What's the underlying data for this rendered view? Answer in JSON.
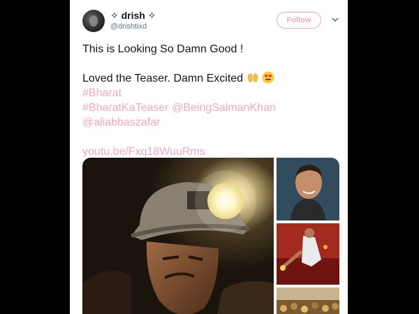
{
  "tweet": {
    "display_name": "drish",
    "name_ornament": "✧",
    "handle": "@drishtixd",
    "follow_label": "Follow",
    "lines": [
      {
        "text": "This is Looking So Damn Good !",
        "kind": "text"
      },
      {
        "text": "",
        "kind": "blank"
      },
      {
        "text": "Loved the Teaser. Damn Excited",
        "kind": "text",
        "emojis": [
          "raising-hands-emoji",
          "heart-eyes-emoji"
        ]
      },
      {
        "text": "#Bharat",
        "kind": "link"
      },
      {
        "text": "#BharatKaTeaser",
        "kind": "link",
        "extra": "@BeingSalmanKhan"
      },
      {
        "text": "@aliabbaszafar",
        "kind": "link"
      },
      {
        "text": "",
        "kind": "blank"
      },
      {
        "text": "youtu.be/Fxq18WuuRms",
        "kind": "link"
      }
    ]
  },
  "media": {
    "images": [
      {
        "name": "miner-helmet-photo"
      },
      {
        "name": "smiling-portrait-photo"
      },
      {
        "name": "dancer-with-lamps-photo"
      },
      {
        "name": "crowd-photo"
      }
    ]
  },
  "colors": {
    "accent": "#f0a8bd",
    "text": "#14171a",
    "muted": "#657786",
    "page_background": "#000000",
    "card_background": "#ffffff"
  }
}
